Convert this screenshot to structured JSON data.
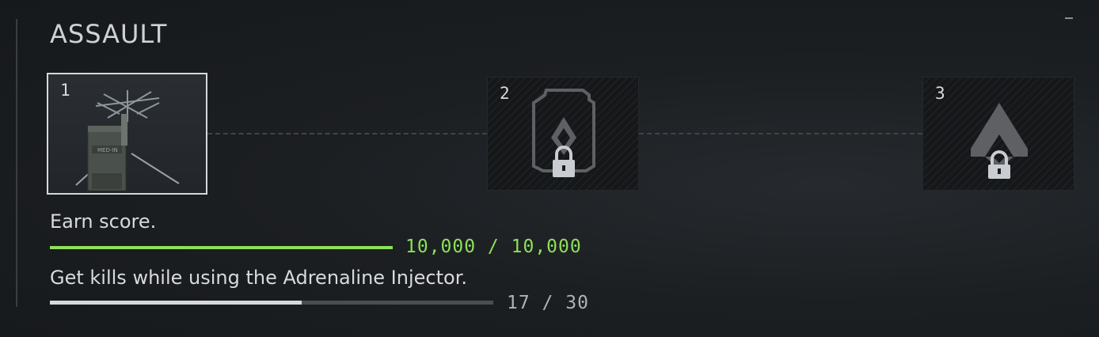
{
  "panel": {
    "title": "ASSAULT",
    "tiers": [
      {
        "number": "1",
        "state": "unlocked",
        "icon": "adrenaline-injector-item-image"
      },
      {
        "number": "2",
        "state": "locked",
        "icon": "class-badge-lock-icon"
      },
      {
        "number": "3",
        "state": "locked",
        "icon": "class-emblem-lock-icon"
      }
    ],
    "objectives": [
      {
        "label": "Earn score.",
        "progress_text": "10,000 / 10,000",
        "progress": 1.0,
        "color": "#8ee05a"
      },
      {
        "label": "Get kills while using the Adrenaline Injector.",
        "progress_text": "17 / 30",
        "progress": 0.567,
        "color": "#d6d9dc"
      }
    ]
  },
  "colors": {
    "accent_green": "#8ee05a",
    "text": "#d8dadc",
    "locked_icon": "#5e6063"
  }
}
